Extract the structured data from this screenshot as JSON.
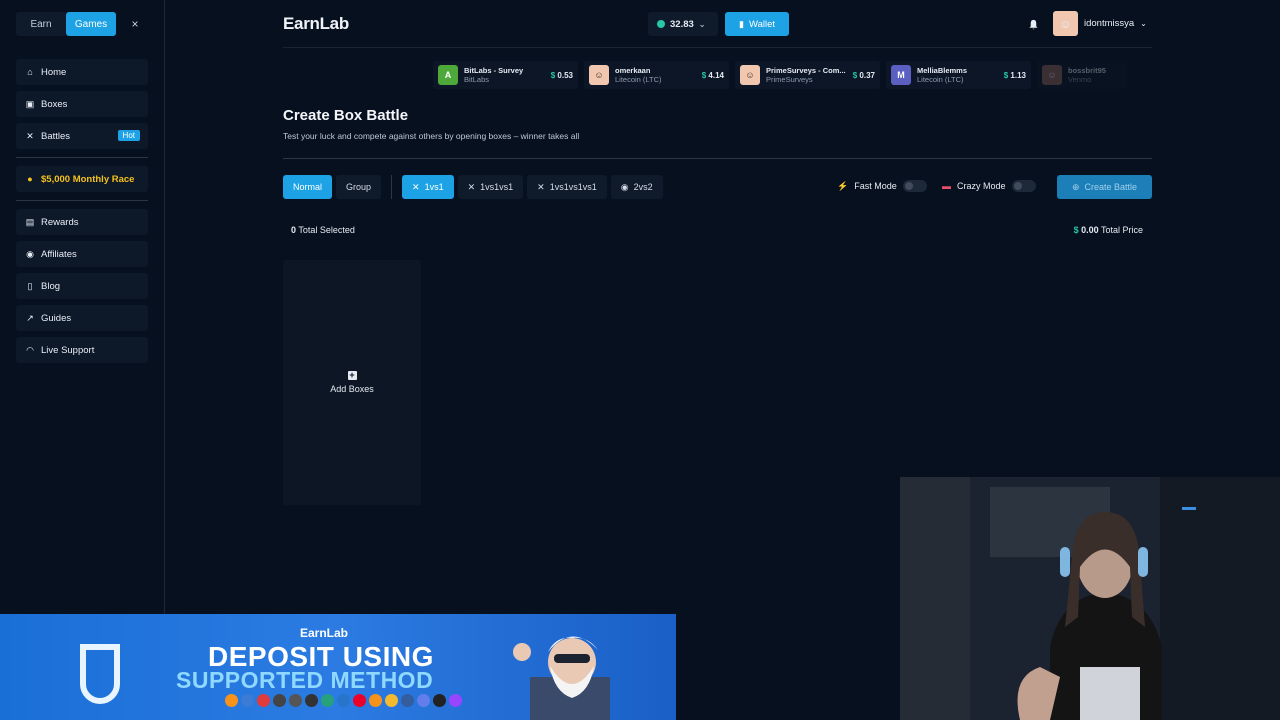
{
  "sidebar": {
    "mode_tabs": [
      "Earn",
      "Games"
    ],
    "close": "×",
    "items": [
      {
        "label": "Home",
        "icon": "home-icon"
      },
      {
        "label": "Boxes",
        "icon": "box-icon"
      },
      {
        "label": "Battles",
        "icon": "swords-icon",
        "badge": "Hot"
      }
    ],
    "race": "$5,000 Monthly Race",
    "items2": [
      {
        "label": "Rewards",
        "icon": "gift-icon"
      },
      {
        "label": "Affiliates",
        "icon": "users-icon"
      },
      {
        "label": "Blog",
        "icon": "document-icon"
      },
      {
        "label": "Guides",
        "icon": "route-icon"
      },
      {
        "label": "Live Support",
        "icon": "headset-icon"
      }
    ]
  },
  "header": {
    "logo": "EarnLab",
    "balance": "32.83",
    "wallet": "Wallet",
    "username": "idontmissya"
  },
  "drops": [
    {
      "name": "BitLabs - Survey",
      "sub": "BitLabs",
      "amount": "0.53",
      "avatar": "A",
      "color": "#4ea83a"
    },
    {
      "name": "omerkaan",
      "sub": "Litecoin (LTC)",
      "amount": "4.14",
      "avatar": "",
      "color": "#f1c7b0"
    },
    {
      "name": "PrimeSurveys - Com...",
      "sub": "PrimeSurveys",
      "amount": "0.37",
      "avatar": "",
      "color": "#f1c7b0"
    },
    {
      "name": "MelliaBlemms",
      "sub": "Litecoin (LTC)",
      "amount": "1.13",
      "avatar": "M",
      "color": "#5b5fc2"
    },
    {
      "name": "bossbrit95",
      "sub": "Venmo",
      "amount": "",
      "avatar": "",
      "color": "#9a6a5a"
    }
  ],
  "page": {
    "title": "Create Box Battle",
    "subtitle": "Test your luck and compete against others by opening boxes – winner takes all"
  },
  "controls": {
    "type_tabs": [
      "Normal",
      "Group"
    ],
    "size_tabs": [
      "1vs1",
      "1vs1vs1",
      "1vs1vs1vs1",
      "2vs2"
    ],
    "fast_mode": "Fast Mode",
    "crazy_mode": "Crazy Mode",
    "create": "Create Battle"
  },
  "summary": {
    "count": "0",
    "count_label": "Total Selected",
    "price_symbol": "$",
    "price": "0.00",
    "price_label": "Total Price"
  },
  "add_boxes": "Add Boxes",
  "banner": {
    "brand": "EarnLab",
    "line1": "DEPOSIT USING",
    "line2": "SUPPORTED METHOD"
  },
  "colors": {
    "accent": "#1ea2e6",
    "gold": "#f4c21c",
    "green": "#25c8a8",
    "bg": "#07101e"
  }
}
